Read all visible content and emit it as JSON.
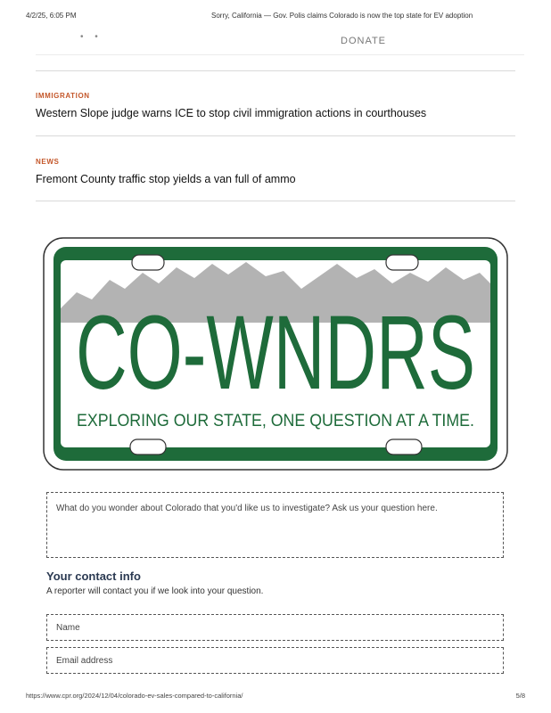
{
  "print_header": {
    "date": "4/2/25, 6:05 PM",
    "title": "Sorry, California — Gov. Polis claims Colorado is now the top state for EV adoption"
  },
  "nav": {
    "dots": "• •",
    "donate_label": "DONATE"
  },
  "stories": [
    {
      "kicker": "IMMIGRATION",
      "headline": "Western Slope judge warns ICE to stop civil immigration actions in courthouses"
    },
    {
      "kicker": "NEWS",
      "headline": "Fremont County traffic stop yields a van full of ammo"
    }
  ],
  "plate": {
    "main_text": "CO-WNDRS",
    "tagline": "EXPLORING OUR STATE, ONE QUESTION AT A TIME.",
    "colors": {
      "green": "#1e6b3a",
      "mountain_gray": "#b3b3b3",
      "white": "#ffffff"
    }
  },
  "form": {
    "question_placeholder": "What do you wonder about Colorado that you'd like us to investigate? Ask us your question here.",
    "contact_title": "Your contact info",
    "contact_subtitle": "A reporter will contact you if we look into your question.",
    "name_placeholder": "Name",
    "email_placeholder": "Email address"
  },
  "print_footer": {
    "url": "https://www.cpr.org/2024/12/04/colorado-ev-sales-compared-to-california/",
    "page": "5/8"
  }
}
